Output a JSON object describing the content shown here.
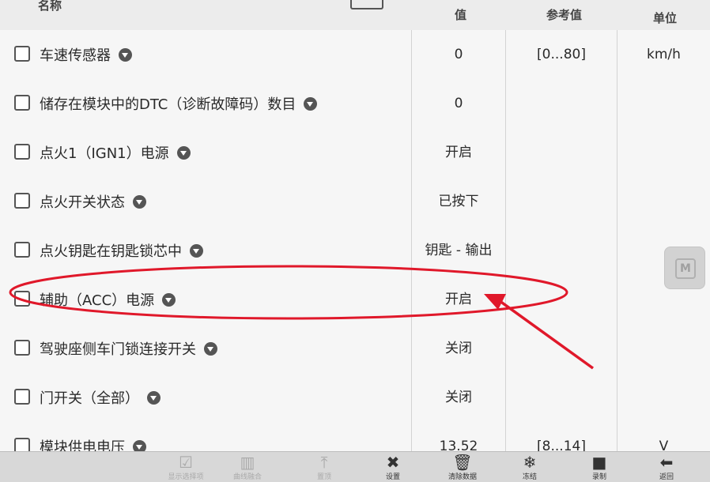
{
  "header": {
    "col_name": "名称",
    "col_value": "值",
    "col_ref": "参考值",
    "col_unit": "单位"
  },
  "rows": [
    {
      "name": "车速传感器",
      "value": "0",
      "ref": "[0...80]",
      "unit": "km/h"
    },
    {
      "name": "储存在模块中的DTC（诊断故障码）数目",
      "value": "0",
      "ref": "",
      "unit": ""
    },
    {
      "name": "点火1（IGN1）电源",
      "value": "开启",
      "ref": "",
      "unit": ""
    },
    {
      "name": "点火开关状态",
      "value": "已按下",
      "ref": "",
      "unit": ""
    },
    {
      "name": "点火钥匙在钥匙锁芯中",
      "value": "钥匙 - 输出",
      "ref": "",
      "unit": ""
    },
    {
      "name": "辅助（ACC）电源",
      "value": "开启",
      "ref": "",
      "unit": ""
    },
    {
      "name": "驾驶座侧车门锁连接开关",
      "value": "关闭",
      "ref": "",
      "unit": ""
    },
    {
      "name": "门开关（全部）",
      "value": "关闭",
      "ref": "",
      "unit": ""
    },
    {
      "name": "模块供电电压",
      "value": "13.52",
      "ref": "[8...14]",
      "unit": "V"
    }
  ],
  "toolbar": {
    "items": [
      {
        "label": "显示选择项",
        "icon": "checkbox-icon",
        "glyph": "☑",
        "enabled": false
      },
      {
        "label": "曲线融合",
        "icon": "chart-icon",
        "glyph": "▥",
        "enabled": false
      },
      {
        "label": "置顶",
        "icon": "pin-top-icon",
        "glyph": "⤒",
        "enabled": false
      },
      {
        "label": "设置",
        "icon": "tools-icon",
        "glyph": "✖",
        "enabled": true
      },
      {
        "label": "清除数据",
        "icon": "trash-icon",
        "glyph": "🗑",
        "enabled": true
      },
      {
        "label": "冻结",
        "icon": "snowflake-icon",
        "glyph": "❄",
        "enabled": true
      },
      {
        "label": "录制",
        "icon": "video-icon",
        "glyph": "■",
        "enabled": true
      },
      {
        "label": "返回",
        "icon": "back-arrow-icon",
        "glyph": "⬅",
        "enabled": true
      }
    ]
  },
  "side_button": {
    "glyph": "M"
  },
  "colors": {
    "annotation": "#e0182a"
  }
}
